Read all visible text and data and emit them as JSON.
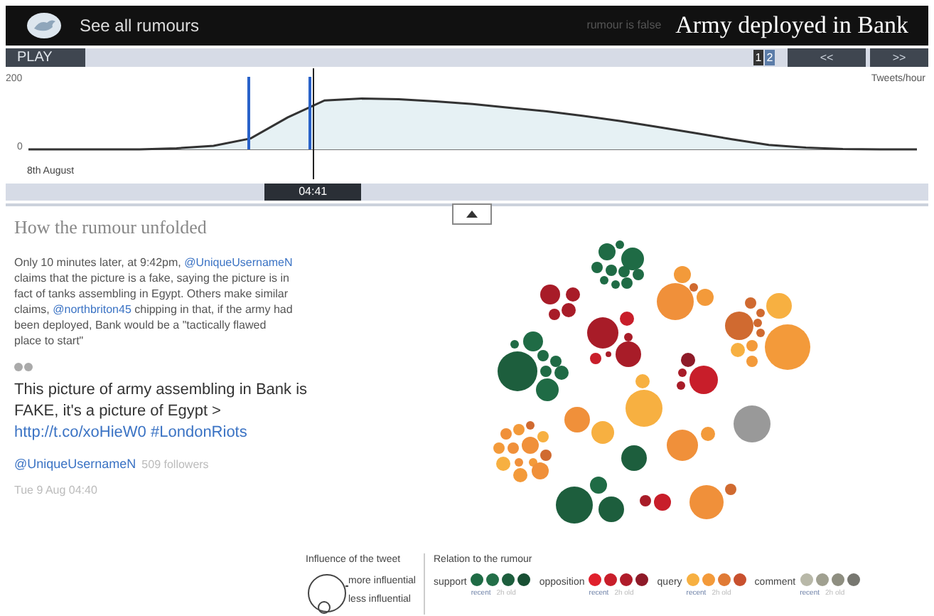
{
  "header": {
    "back_link": "See all rumours",
    "verdict": "rumour is false",
    "title": "Army deployed in Bank"
  },
  "controls": {
    "play": "PLAY",
    "pages": [
      {
        "label": "1",
        "selected": true
      },
      {
        "label": "2",
        "selected": false
      }
    ],
    "prev": "<<",
    "next": ">>"
  },
  "timeline": {
    "chart_data": {
      "type": "area",
      "ylabel": "Tweets/hour",
      "xlabel": "8th August",
      "yticks": [
        0,
        200
      ],
      "ylim": [
        0,
        200
      ],
      "values": [
        0,
        0,
        0,
        0,
        3,
        10,
        30,
        88,
        135,
        140,
        138,
        132,
        125,
        115,
        105,
        92,
        78,
        62,
        45,
        28,
        12,
        5,
        1,
        0,
        0
      ]
    },
    "slider": {
      "label": "04:41",
      "level": 0.335
    }
  },
  "story": {
    "heading": "How the rumour unfolded",
    "paragraph": [
      {
        "kind": "text",
        "text": "Only 10 minutes later, at 9:42pm, "
      },
      {
        "kind": "mention",
        "text": "@UniqueUsernameN"
      },
      {
        "kind": "text",
        "text": " claims that the picture is a fake, saying the picture is in fact of tanks assembling in Egypt. Others make similar claims, "
      },
      {
        "kind": "mention",
        "text": "@northbriton45"
      },
      {
        "kind": "text",
        "text": " chipping in that, if the army had been deployed, Bank would be a \"tactically flawed place to start\""
      }
    ],
    "tweet": {
      "segments": [
        {
          "kind": "text",
          "text": "This picture of army assembling in Bank is FAKE, it's a picture of Egypt > "
        },
        {
          "kind": "mention",
          "text": "http://t.co/xoHieW0 #LondonRiots"
        }
      ],
      "author": "@UniqueUsernameN",
      "followers": "509 followers",
      "time": "Tue 9 Aug 04:40"
    }
  },
  "legend": {
    "influence": {
      "title": "Influence of the tweet",
      "more": "more influential",
      "less": "less influential"
    },
    "relation": {
      "title": "Relation to the rumour",
      "groups": [
        {
          "label": "support",
          "dots": [
            {
              "color": "#1f6b45"
            },
            {
              "color": "#236f48"
            },
            {
              "color": "#1d5e3d"
            },
            {
              "color": "#184f33"
            }
          ],
          "recent": "recent",
          "old": "2h old"
        },
        {
          "label": "opposition",
          "dots": [
            {
              "color": "#e0202c"
            },
            {
              "color": "#c81e2a"
            },
            {
              "color": "#b01c2a"
            },
            {
              "color": "#8e1a28"
            }
          ],
          "recent": "recent",
          "old": "2h old"
        },
        {
          "label": "query",
          "dots": [
            {
              "color": "#f7b041"
            },
            {
              "color": "#f39a3a"
            },
            {
              "color": "#e07a35"
            },
            {
              "color": "#c8502e"
            }
          ],
          "recent": "recent",
          "old": "2h old"
        },
        {
          "label": "comment",
          "dots": [
            {
              "color": "#b8b8a8"
            },
            {
              "color": "#a0a090"
            },
            {
              "color": "#8e8e80"
            },
            {
              "color": "#777770"
            }
          ],
          "recent": "recent",
          "old": "2h old"
        }
      ]
    }
  }
}
